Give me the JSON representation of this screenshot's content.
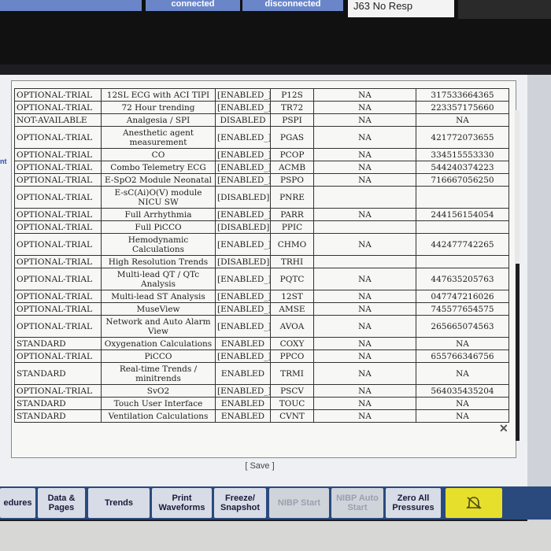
{
  "topbar": {
    "btn1": "",
    "btn2": "connected",
    "btn3": "disconnected",
    "status": "J63 No Resp"
  },
  "side_label": "nt",
  "table": {
    "rows": [
      [
        "OPTIONAL-TRIAL",
        "12SL ECG with ACI TIPI",
        "[ENABLED_]",
        "P12S",
        "NA",
        "317533664365"
      ],
      [
        "OPTIONAL-TRIAL",
        "72 Hour trending",
        "[ENABLED_]",
        "TR72",
        "NA",
        "223357175660"
      ],
      [
        "NOT-AVAILABLE",
        "Analgesia / SPI",
        "DISABLED",
        "PSPI",
        "NA",
        "NA"
      ],
      [
        "OPTIONAL-TRIAL",
        "Anesthetic agent measurement",
        "[ENABLED_]",
        "PGAS",
        "NA",
        "421772073655"
      ],
      [
        "OPTIONAL-TRIAL",
        "CO",
        "[ENABLED_]",
        "PCOP",
        "NA",
        "334515553330"
      ],
      [
        "OPTIONAL-TRIAL",
        "Combo Telemetry ECG",
        "[ENABLED_]",
        "ACMB",
        "NA",
        "544240374223"
      ],
      [
        "OPTIONAL-TRIAL",
        "E-SpO2 Module Neonatal",
        "[ENABLED_]",
        "PSPO",
        "NA",
        "716667056250"
      ],
      [
        "OPTIONAL-TRIAL",
        "E-sC(Ai)O(V) module NICU SW",
        "[DISABLED]",
        "PNRE",
        "",
        ""
      ],
      [
        "OPTIONAL-TRIAL",
        "Full Arrhythmia",
        "[ENABLED_]",
        "PARR",
        "NA",
        "244156154054"
      ],
      [
        "OPTIONAL-TRIAL",
        "Full PiCCO",
        "[DISABLED]",
        "PPIC",
        "",
        ""
      ],
      [
        "OPTIONAL-TRIAL",
        "Hemodynamic Calculations",
        "[ENABLED_]",
        "CHMO",
        "NA",
        "442477742265"
      ],
      [
        "OPTIONAL-TRIAL",
        "High Resolution Trends",
        "[DISABLED]",
        "TRHI",
        "",
        ""
      ],
      [
        "OPTIONAL-TRIAL",
        "Multi-lead QT / QTc Analysis",
        "[ENABLED_]",
        "PQTC",
        "NA",
        "447635205763"
      ],
      [
        "OPTIONAL-TRIAL",
        "Multi-lead ST Analysis",
        "[ENABLED_]",
        "12ST",
        "NA",
        "047747216026"
      ],
      [
        "OPTIONAL-TRIAL",
        "MuseView",
        "[ENABLED_]",
        "AMSE",
        "NA",
        "745577654575"
      ],
      [
        "OPTIONAL-TRIAL",
        "Network and Auto Alarm View",
        "[ENABLED_]",
        "AVOA",
        "NA",
        "265665074563"
      ],
      [
        "STANDARD",
        "Oxygenation Calculations",
        "ENABLED",
        "COXY",
        "NA",
        "NA"
      ],
      [
        "OPTIONAL-TRIAL",
        "PiCCO",
        "[ENABLED_]",
        "PPCO",
        "NA",
        "655766346756"
      ],
      [
        "STANDARD",
        "Real-time Trends / minitrends",
        "ENABLED",
        "TRMI",
        "NA",
        "NA"
      ],
      [
        "OPTIONAL-TRIAL",
        "SvO2",
        "[ENABLED_]",
        "PSCV",
        "NA",
        "564035435204"
      ],
      [
        "STANDARD",
        "Touch User Interface",
        "ENABLED",
        "TOUC",
        "NA",
        "NA"
      ],
      [
        "STANDARD",
        "Ventilation Calculations",
        "ENABLED",
        "CVNT",
        "NA",
        "NA"
      ]
    ]
  },
  "save_label": "[ Save ]",
  "softkeys": {
    "k0": "edures",
    "k1": "Data & Pages",
    "k2": "Trends",
    "k3": "Print Waveforms",
    "k4": "Freeze/ Snapshot",
    "k5": "NIBP Start",
    "k6": "NIBP Auto Start",
    "k7": "Zero All Pressures",
    "k8_icon": "alarm-silence-icon"
  }
}
